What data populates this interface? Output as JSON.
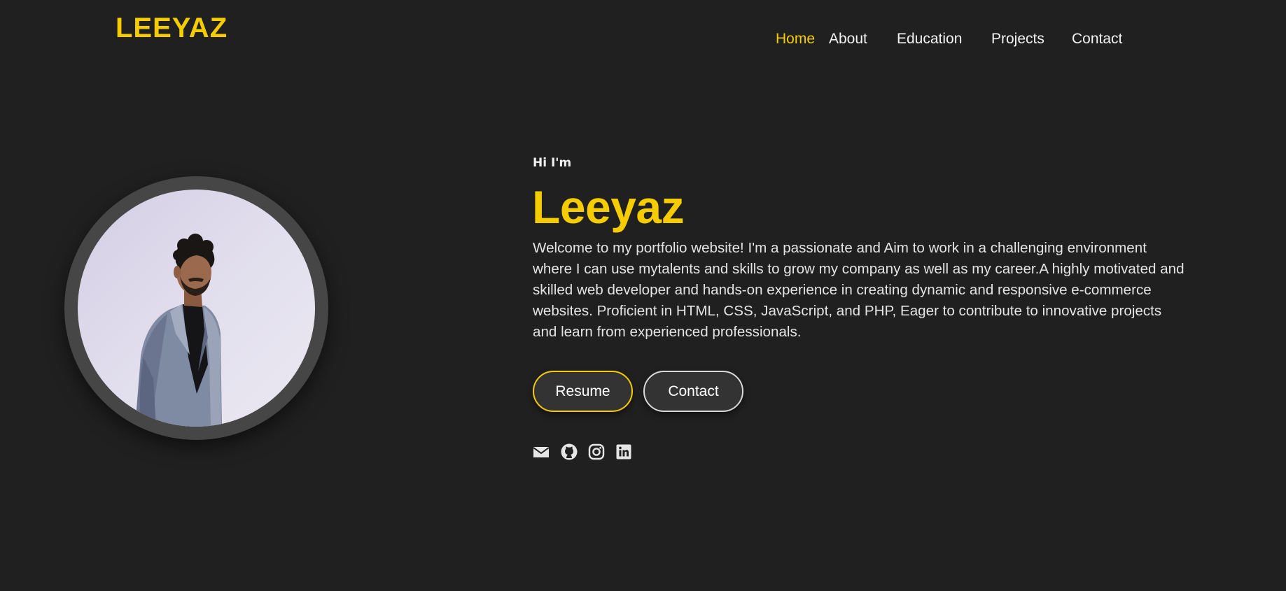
{
  "header": {
    "logo": "LEEYAZ",
    "nav": [
      {
        "label": "Home",
        "active": true
      },
      {
        "label": "About",
        "active": false
      },
      {
        "label": "Education",
        "active": false
      },
      {
        "label": "Projects",
        "active": false
      },
      {
        "label": "Contact",
        "active": false
      }
    ]
  },
  "hero": {
    "greeting": "Hi I'm",
    "name": "Leeyaz",
    "intro": "Welcome to my portfolio website! I'm a passionate and Aim to work in a challenging environment where I can use mytalents and skills to grow my company as well as my career.A highly motivated and skilled web developer and hands-on experience in creating dynamic and responsive e-commerce websites. Proficient in HTML, CSS, JavaScript, and PHP, Eager to contribute to innovative projects and learn from experienced professionals.",
    "buttons": {
      "resume": "Resume",
      "contact": "Contact"
    },
    "socials": [
      "envelope-icon",
      "github-icon",
      "instagram-icon",
      "linkedin-icon"
    ]
  },
  "colors": {
    "background": "#202020",
    "accent": "#f5cc00",
    "text": "#e8e8e8",
    "button_bg": "#333333"
  }
}
